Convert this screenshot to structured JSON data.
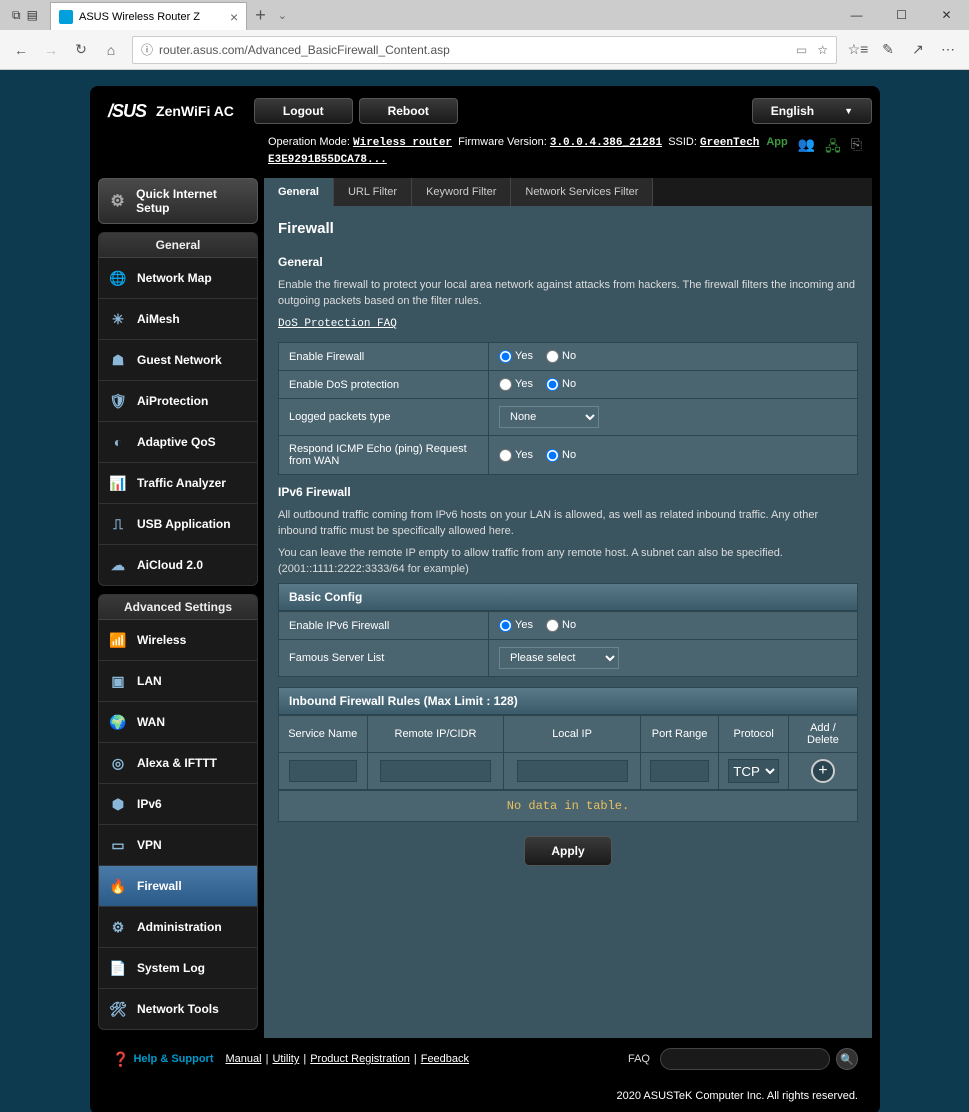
{
  "browser": {
    "tab_title": "ASUS Wireless Router Z",
    "url": "router.asus.com/Advanced_BasicFirewall_Content.asp"
  },
  "header": {
    "model": "ZenWiFi AC",
    "logout": "Logout",
    "reboot": "Reboot",
    "language": "English"
  },
  "info": {
    "op_mode_label": "Operation Mode:",
    "op_mode": "Wireless router",
    "fw_label": "Firmware Version:",
    "fw": "3.0.0.4.386_21281",
    "ssid_label": "SSID:",
    "ssid": "GreenTech",
    "mac": "E3E9291B55DCA78...",
    "app": "App"
  },
  "sidebar": {
    "qis": "Quick Internet Setup",
    "general_header": "General",
    "general": [
      "Network Map",
      "AiMesh",
      "Guest Network",
      "AiProtection",
      "Adaptive QoS",
      "Traffic Analyzer",
      "USB Application",
      "AiCloud 2.0"
    ],
    "adv_header": "Advanced Settings",
    "adv": [
      "Wireless",
      "LAN",
      "WAN",
      "Alexa & IFTTT",
      "IPv6",
      "VPN",
      "Firewall",
      "Administration",
      "System Log",
      "Network Tools"
    ]
  },
  "tabs": [
    "General",
    "URL Filter",
    "Keyword Filter",
    "Network Services Filter"
  ],
  "page": {
    "title": "Firewall",
    "general_heading": "General",
    "general_desc": "Enable the firewall to protect your local area network against attacks from hackers. The firewall filters the incoming and outgoing packets based on the filter rules.",
    "dos_link": "DoS Protection FAQ",
    "rows": {
      "enable_fw": "Enable Firewall",
      "enable_dos": "Enable DoS protection",
      "logged": "Logged packets type",
      "logged_val": "None",
      "icmp": "Respond ICMP Echo (ping) Request from WAN"
    },
    "yes": "Yes",
    "no": "No",
    "ipv6_heading": "IPv6 Firewall",
    "ipv6_desc1": "All outbound traffic coming from IPv6 hosts on your LAN is allowed, as well as related inbound traffic. Any other inbound traffic must be specifically allowed here.",
    "ipv6_desc2": "You can leave the remote IP empty to allow traffic from any remote host. A subnet can also be specified. (2001::1111:2222:3333/64 for example)",
    "basic_config": "Basic Config",
    "enable_ipv6": "Enable IPv6 Firewall",
    "famous": "Famous Server List",
    "famous_val": "Please select",
    "rules_header": "Inbound Firewall Rules (Max Limit : 128)",
    "cols": [
      "Service Name",
      "Remote IP/CIDR",
      "Local IP",
      "Port Range",
      "Protocol",
      "Add / Delete"
    ],
    "protocol": "TCP",
    "nodata": "No data in table.",
    "apply": "Apply"
  },
  "footer": {
    "help": "Help & Support",
    "links": [
      "Manual",
      "Utility",
      "Product Registration",
      "Feedback"
    ],
    "faq": "FAQ",
    "copyright": "2020 ASUSTeK Computer Inc. All rights reserved."
  }
}
